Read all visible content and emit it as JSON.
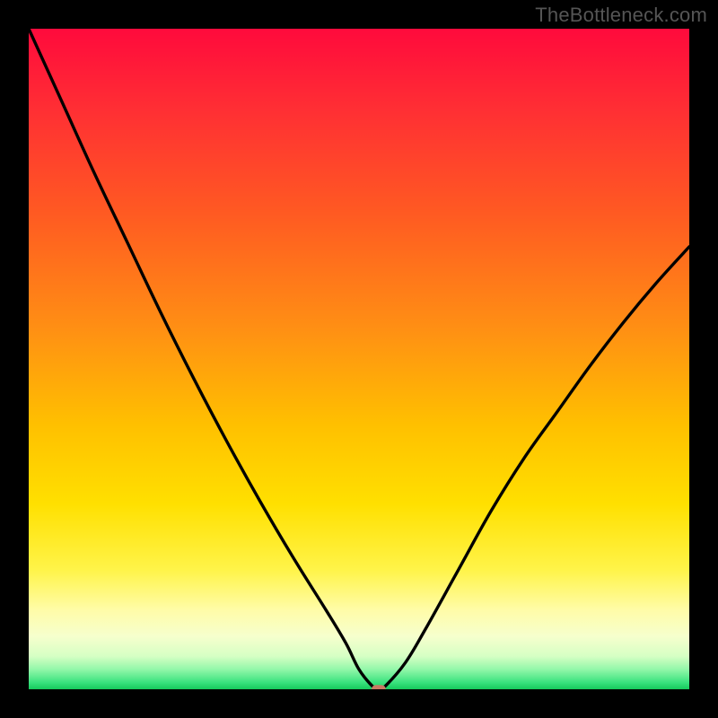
{
  "watermark": "TheBottleneck.com",
  "chart_data": {
    "type": "line",
    "title": "",
    "xlabel": "",
    "ylabel": "",
    "xlim": [
      0,
      100
    ],
    "ylim": [
      0,
      100
    ],
    "grid": false,
    "legend": false,
    "series": [
      {
        "name": "bottleneck-curve",
        "x": [
          0,
          5,
          10,
          15,
          20,
          25,
          30,
          35,
          40,
          45,
          48,
          50,
          52,
          53,
          54,
          57,
          60,
          65,
          70,
          75,
          80,
          85,
          90,
          95,
          100
        ],
        "values": [
          100,
          89,
          78,
          67.5,
          57,
          47,
          37.5,
          28.5,
          20,
          12,
          7,
          3,
          0.5,
          0,
          0.5,
          4,
          9,
          18,
          27,
          35,
          42,
          49,
          55.5,
          61.5,
          67
        ]
      }
    ],
    "marker": {
      "x": 53,
      "y": 0,
      "color": "#c77a63",
      "width_pct": 2.2,
      "height_pct": 1.3
    },
    "background_gradient": {
      "direction": "top-to-bottom",
      "stops": [
        {
          "pos": 0.0,
          "color": "#ff0a3c"
        },
        {
          "pos": 0.12,
          "color": "#ff2e34"
        },
        {
          "pos": 0.28,
          "color": "#ff5a22"
        },
        {
          "pos": 0.45,
          "color": "#ff8e14"
        },
        {
          "pos": 0.6,
          "color": "#ffc000"
        },
        {
          "pos": 0.72,
          "color": "#ffe000"
        },
        {
          "pos": 0.82,
          "color": "#fff44a"
        },
        {
          "pos": 0.88,
          "color": "#fffca8"
        },
        {
          "pos": 0.92,
          "color": "#f6ffcd"
        },
        {
          "pos": 0.95,
          "color": "#d6ffc4"
        },
        {
          "pos": 0.97,
          "color": "#92f7a9"
        },
        {
          "pos": 0.99,
          "color": "#38e27d"
        },
        {
          "pos": 1.0,
          "color": "#16c95c"
        }
      ]
    }
  }
}
